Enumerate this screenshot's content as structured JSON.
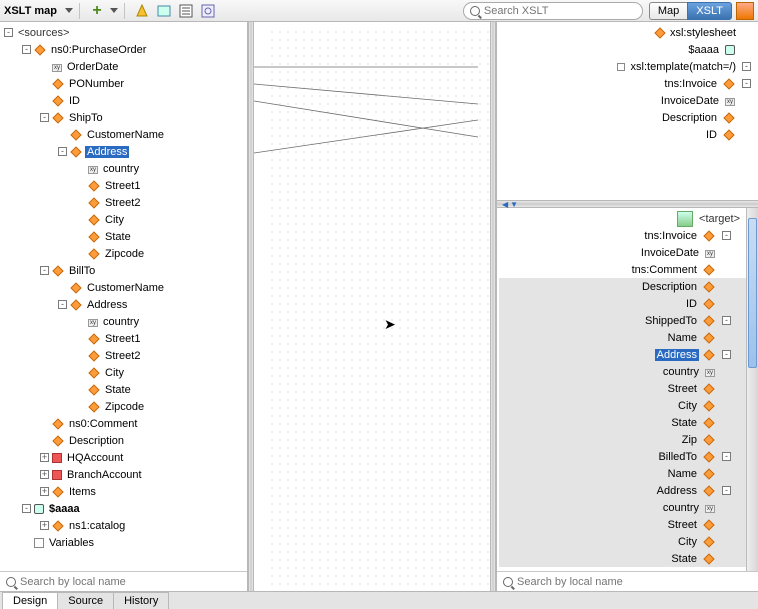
{
  "toolbar": {
    "title": "XSLT map",
    "search_placeholder": "Search XSLT",
    "mode_map": "Map",
    "mode_xslt": "XSLT"
  },
  "source_tree": {
    "root": "<sources>",
    "children": [
      {
        "icon": "el",
        "label": "ns0:PurchaseOrder",
        "exp": "-",
        "depth": 0,
        "children": [
          {
            "icon": "attr",
            "label": "OrderDate",
            "depth": 1
          },
          {
            "icon": "el",
            "label": "PONumber",
            "depth": 1
          },
          {
            "icon": "el",
            "label": "ID",
            "depth": 1
          },
          {
            "icon": "el",
            "label": "ShipTo",
            "exp": "-",
            "depth": 1,
            "children": [
              {
                "icon": "el",
                "label": "CustomerName",
                "depth": 2
              },
              {
                "icon": "el",
                "label": "Address",
                "exp": "-",
                "depth": 2,
                "selected": true,
                "children": [
                  {
                    "icon": "attr",
                    "label": "country",
                    "depth": 3
                  },
                  {
                    "icon": "el",
                    "label": "Street1",
                    "depth": 3
                  },
                  {
                    "icon": "el",
                    "label": "Street2",
                    "depth": 3
                  },
                  {
                    "icon": "el",
                    "label": "City",
                    "depth": 3
                  },
                  {
                    "icon": "el",
                    "label": "State",
                    "depth": 3
                  },
                  {
                    "icon": "el",
                    "label": "Zipcode",
                    "depth": 3
                  }
                ]
              }
            ]
          },
          {
            "icon": "el",
            "label": "BillTo",
            "exp": "-",
            "depth": 1,
            "children": [
              {
                "icon": "el",
                "label": "CustomerName",
                "depth": 2
              },
              {
                "icon": "el",
                "label": "Address",
                "exp": "-",
                "depth": 2,
                "children": [
                  {
                    "icon": "attr",
                    "label": "country",
                    "depth": 3
                  },
                  {
                    "icon": "el",
                    "label": "Street1",
                    "depth": 3
                  },
                  {
                    "icon": "el",
                    "label": "Street2",
                    "depth": 3
                  },
                  {
                    "icon": "el",
                    "label": "City",
                    "depth": 3
                  },
                  {
                    "icon": "el",
                    "label": "State",
                    "depth": 3
                  },
                  {
                    "icon": "el",
                    "label": "Zipcode",
                    "depth": 3
                  }
                ]
              }
            ]
          },
          {
            "icon": "el",
            "label": "ns0:Comment",
            "depth": 1
          },
          {
            "icon": "el",
            "label": "Description",
            "depth": 1
          },
          {
            "icon": "br",
            "label": "HQAccount",
            "exp": "+",
            "depth": 1
          },
          {
            "icon": "br",
            "label": "BranchAccount",
            "exp": "+",
            "depth": 1
          },
          {
            "icon": "el",
            "label": "Items",
            "exp": "+",
            "depth": 1
          }
        ]
      },
      {
        "icon": "var",
        "label": "$aaaa",
        "bold": true,
        "exp": "-",
        "depth": 0,
        "children": [
          {
            "icon": "el",
            "label": "ns1:catalog",
            "exp": "+",
            "depth": 1
          }
        ]
      },
      {
        "icon": "grp",
        "label": "Variables",
        "depth": 0
      }
    ]
  },
  "template": {
    "items": [
      {
        "label": "xsl:stylesheet",
        "icon": "diamond",
        "toggle": ""
      },
      {
        "label": "$aaaa",
        "icon": "var",
        "toggle": ""
      },
      {
        "label": "xsl:template(match=/)",
        "icon": "port",
        "toggle": "-"
      },
      {
        "label": "tns:Invoice",
        "icon": "el",
        "toggle": "-"
      },
      {
        "label": "InvoiceDate",
        "icon": "attr",
        "toggle": ""
      },
      {
        "label": "Description",
        "icon": "el",
        "toggle": ""
      },
      {
        "label": "ID",
        "icon": "el",
        "toggle": ""
      }
    ]
  },
  "target": {
    "root": "<target>",
    "items": [
      {
        "label": "tns:Invoice",
        "icon": "el",
        "toggle": "-",
        "ind": 0
      },
      {
        "label": "InvoiceDate",
        "icon": "attr",
        "ind": 1
      },
      {
        "label": "tns:Comment",
        "icon": "el",
        "ind": 1
      },
      {
        "label": "Description",
        "icon": "el",
        "ind": 1,
        "shade": true
      },
      {
        "label": "ID",
        "icon": "el",
        "ind": 1,
        "shade": true
      },
      {
        "label": "ShippedTo",
        "icon": "el",
        "toggle": "-",
        "ind": 1,
        "shade": true
      },
      {
        "label": "Name",
        "icon": "el",
        "ind": 2,
        "shade": true
      },
      {
        "label": "Address",
        "icon": "el",
        "toggle": "-",
        "ind": 2,
        "selected": true,
        "shade": true
      },
      {
        "label": "country",
        "icon": "attr",
        "ind": 3,
        "shade": true
      },
      {
        "label": "Street",
        "icon": "el",
        "ind": 3,
        "shade": true
      },
      {
        "label": "City",
        "icon": "el",
        "ind": 3,
        "shade": true
      },
      {
        "label": "State",
        "icon": "el",
        "ind": 3,
        "shade": true
      },
      {
        "label": "Zip",
        "icon": "el",
        "ind": 3,
        "shade": true
      },
      {
        "label": "BilledTo",
        "icon": "el",
        "toggle": "-",
        "ind": 1,
        "shade": true
      },
      {
        "label": "Name",
        "icon": "el",
        "ind": 2,
        "shade": true
      },
      {
        "label": "Address",
        "icon": "el",
        "toggle": "-",
        "ind": 2,
        "shade": true
      },
      {
        "label": "country",
        "icon": "attr",
        "ind": 3,
        "shade": true
      },
      {
        "label": "Street",
        "icon": "el",
        "ind": 3,
        "shade": true
      },
      {
        "label": "City",
        "icon": "el",
        "ind": 3,
        "shade": true
      },
      {
        "label": "State",
        "icon": "el",
        "ind": 3,
        "shade": true
      }
    ]
  },
  "search": {
    "left_placeholder": "Search by local name",
    "right_placeholder": "Search by local name"
  },
  "bottom_tabs": {
    "design": "Design",
    "source": "Source",
    "history": "History"
  }
}
